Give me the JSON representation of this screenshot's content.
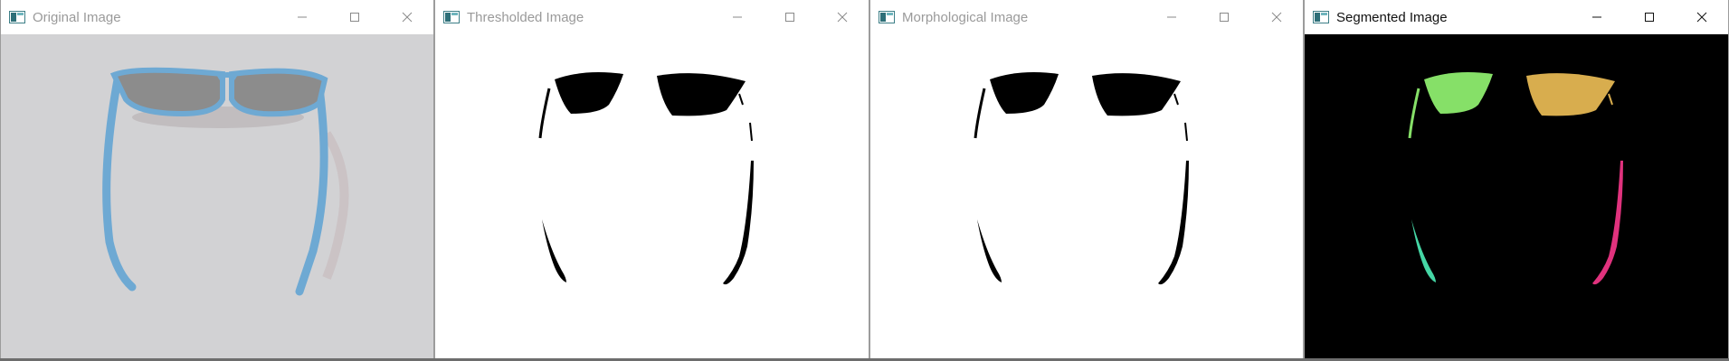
{
  "windows": [
    {
      "title": "Original Image",
      "active": false,
      "icons": {
        "app": "app-window-icon",
        "minimize": "minimize-icon",
        "maximize": "maximize-icon",
        "close": "close-icon"
      },
      "background": "#d2d2d4"
    },
    {
      "title": "Thresholded Image",
      "active": false,
      "icons": {
        "app": "app-window-icon",
        "minimize": "minimize-icon",
        "maximize": "maximize-icon",
        "close": "close-icon"
      },
      "background": "#ffffff"
    },
    {
      "title": "Morphological Image",
      "active": false,
      "icons": {
        "app": "app-window-icon",
        "minimize": "minimize-icon",
        "maximize": "maximize-icon",
        "close": "close-icon"
      },
      "background": "#ffffff"
    },
    {
      "title": "Segmented Image",
      "active": true,
      "icons": {
        "app": "app-window-icon",
        "minimize": "minimize-icon",
        "maximize": "maximize-icon",
        "close": "close-icon"
      },
      "background": "#000000"
    }
  ],
  "colors": {
    "frame_blue": "#6ea9d3",
    "lens_gray": "#8c8c8c",
    "segment_lens_left": "#86e068",
    "segment_lens_right": "#d8ad4e",
    "segment_arm_left": "#45d6a5",
    "segment_arm_right": "#e0327d"
  }
}
